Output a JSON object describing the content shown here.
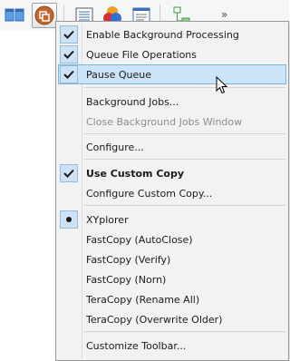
{
  "toolbar": {
    "buttons": [
      {
        "icon": "dual-pane-icon"
      },
      {
        "icon": "copy-queue-icon",
        "active": true
      },
      {
        "icon": "details-view-icon"
      },
      {
        "icon": "color-filter-icon"
      },
      {
        "icon": "window-icon"
      },
      {
        "icon": "network-tree-icon"
      }
    ],
    "overflow_label": "»"
  },
  "menu": {
    "items": [
      {
        "label": "Enable Background Processing",
        "checked": true
      },
      {
        "label": "Queue File Operations",
        "checked": true
      },
      {
        "label": "Pause Queue",
        "checked": true,
        "highlighted": true
      },
      {
        "label": "Background Jobs..."
      },
      {
        "label": "Close Background Jobs Window",
        "disabled": true
      },
      {
        "label": "Configure..."
      },
      {
        "label": "Use Custom Copy",
        "checked": true,
        "bold": true
      },
      {
        "label": "Configure Custom Copy..."
      },
      {
        "label": "XYplorer",
        "radio": true
      },
      {
        "label": "FastCopy (AutoClose)"
      },
      {
        "label": "FastCopy (Verify)"
      },
      {
        "label": "FastCopy (Norn)"
      },
      {
        "label": "TeraCopy (Rename All)"
      },
      {
        "label": "TeraCopy (Overwrite Older)"
      },
      {
        "label": "Customize Toolbar..."
      }
    ]
  },
  "colors": {
    "highlight_bg": "#cce4f7",
    "highlight_border": "#7ab3e0",
    "check_bg": "#cde3f5",
    "disabled_text": "#8d8d8d"
  }
}
